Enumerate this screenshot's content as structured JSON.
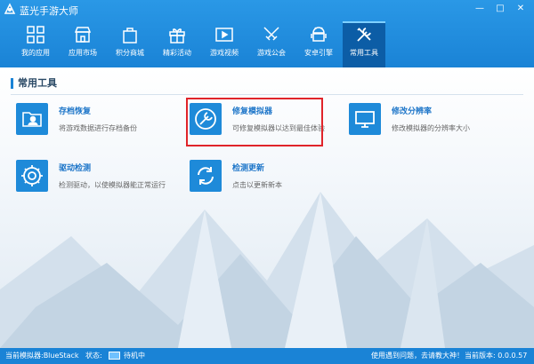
{
  "window": {
    "title": "蓝光手游大师",
    "min": "—",
    "max": "□",
    "close": "✕"
  },
  "nav": [
    {
      "label": "我的应用",
      "icon": "grid-icon"
    },
    {
      "label": "应用市场",
      "icon": "store-icon"
    },
    {
      "label": "积分商城",
      "icon": "bag-icon"
    },
    {
      "label": "精彩活动",
      "icon": "gift-icon"
    },
    {
      "label": "游戏视频",
      "icon": "video-icon"
    },
    {
      "label": "游戏公会",
      "icon": "swords-icon"
    },
    {
      "label": "安卓引擎",
      "icon": "android-icon"
    },
    {
      "label": "常用工具",
      "icon": "tools-icon",
      "active": true
    }
  ],
  "section": {
    "title": "常用工具"
  },
  "tools": [
    {
      "name": "存档恢复",
      "desc": "将游戏数据进行存档备份",
      "icon": "folder-user-icon"
    },
    {
      "name": "修复模拟器",
      "desc": "可修复模拟器以达到最佳体验",
      "icon": "wrench-icon"
    },
    {
      "name": "修改分辨率",
      "desc": "修改模拟器的分辨率大小",
      "icon": "monitor-icon"
    },
    {
      "name": "驱动检测",
      "desc": "检测驱动，以使模拟器能正常运行",
      "icon": "gear-icon"
    },
    {
      "name": "检测更新",
      "desc": "点击以更新新本",
      "icon": "refresh-icon"
    }
  ],
  "status": {
    "emulator": "当前模拟器:BlueStack",
    "state_label": "状态:",
    "state": "待机中",
    "help": "使用遇到问题，去请教大神！",
    "version": "当前版本: 0.0.0.57"
  },
  "colors": {
    "accent": "#1a83d6",
    "active_nav": "#0c5da6",
    "highlight": "#e0242a"
  }
}
